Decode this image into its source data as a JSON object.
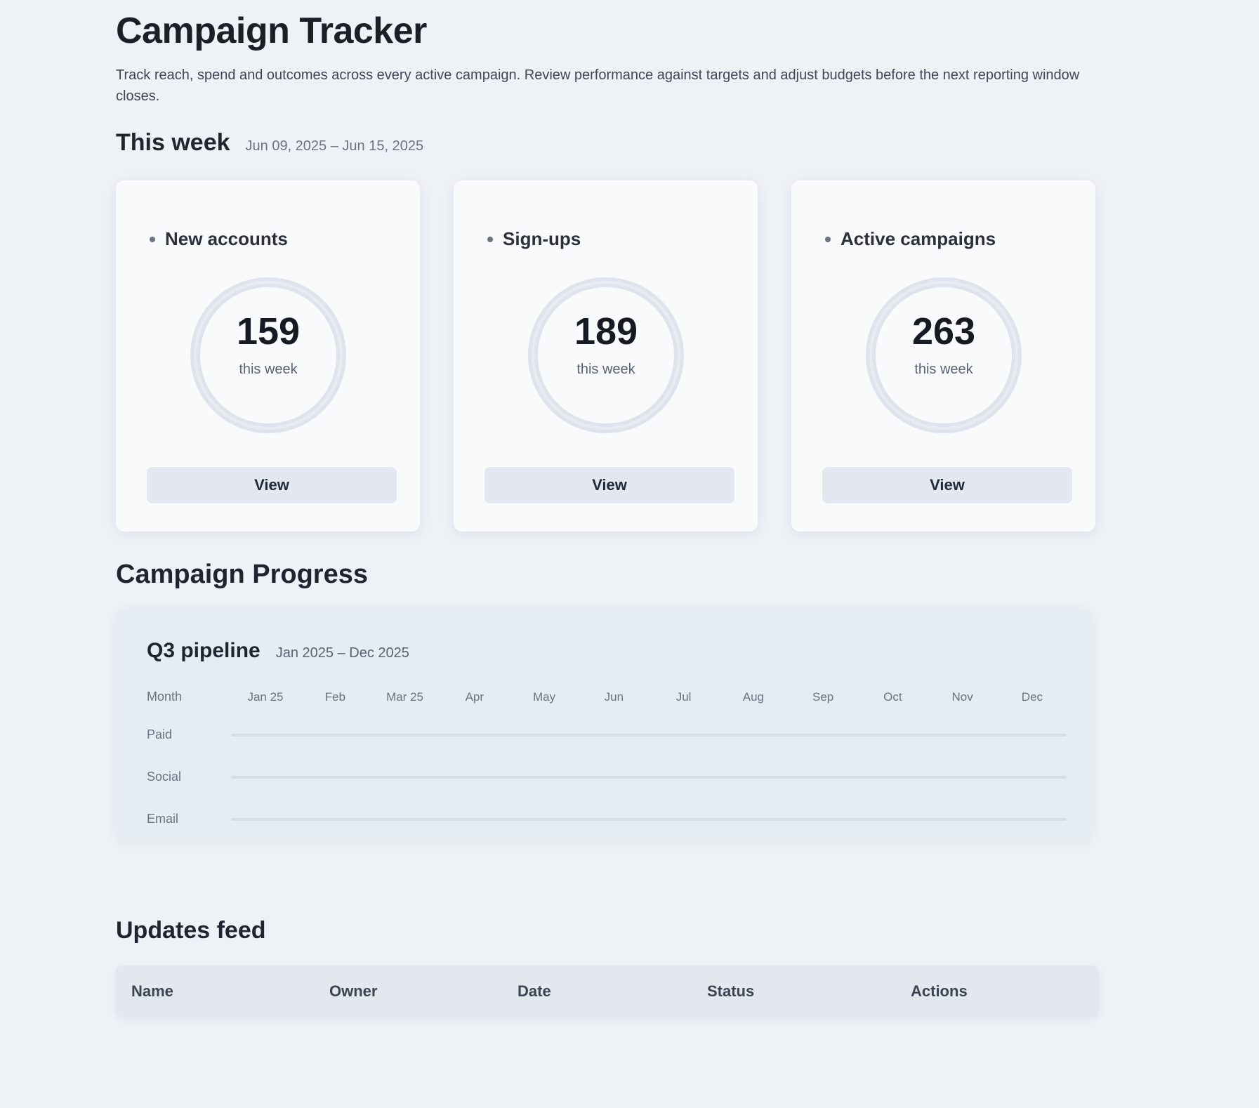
{
  "header": {
    "title": "Campaign Tracker",
    "subtitle": "Track reach, spend and outcomes across every active campaign. Review performance against targets and adjust budgets before the next reporting window closes."
  },
  "this_week": {
    "title": "This week",
    "dates": "Jun 09, 2025 – Jun 15, 2025"
  },
  "cards": [
    {
      "label": "New accounts",
      "value": "159",
      "caption": "this week",
      "button": "View"
    },
    {
      "label": "Sign-ups",
      "value": "189",
      "caption": "this week",
      "button": "View"
    },
    {
      "label": "Active campaigns",
      "value": "263",
      "caption": "this week",
      "button": "View"
    }
  ],
  "progress": {
    "section_title": "Campaign Progress",
    "card_title": "Q3 pipeline",
    "dates": "Jan 2025 – Dec 2025",
    "header_label": "Month",
    "months": [
      "Jan 25",
      "Feb",
      "Mar 25",
      "Apr",
      "May",
      "Jun",
      "Jul",
      "Aug",
      "Sep",
      "Oct",
      "Nov",
      "Dec"
    ],
    "rows": [
      "Paid",
      "Social",
      "Email"
    ]
  },
  "updates": {
    "title": "Updates feed",
    "columns": [
      "Name",
      "Owner",
      "Date",
      "Status",
      "Actions"
    ]
  }
}
